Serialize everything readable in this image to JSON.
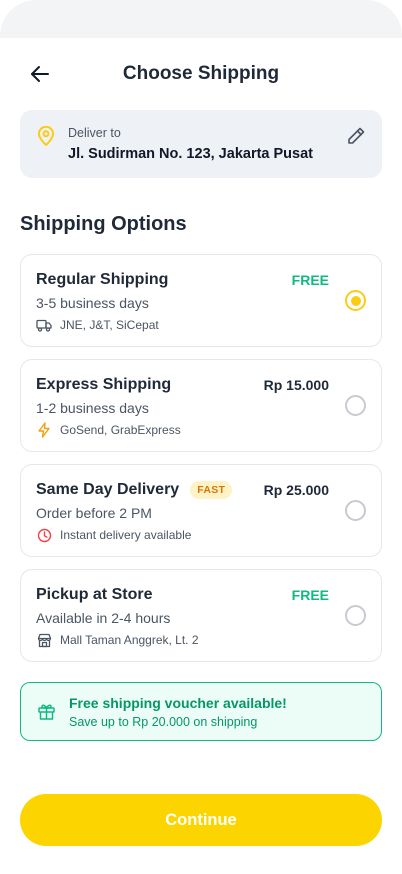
{
  "header": {
    "title": "Choose Shipping"
  },
  "address": {
    "label": "Deliver to",
    "value": "Jl. Sudirman No. 123, Jakarta Pusat"
  },
  "section_title": "Shipping Options",
  "options": [
    {
      "name": "Regular Shipping",
      "price": "FREE",
      "subtitle": "3-5 business days",
      "meta": "JNE, J&T, SiCepat",
      "meta_icon": "truck-icon",
      "selected": true
    },
    {
      "name": "Express Shipping",
      "price": "Rp 15.000",
      "subtitle": "1-2 business days",
      "meta": "GoSend, GrabExpress",
      "meta_icon": "lightning-icon",
      "selected": false
    },
    {
      "name": "Same Day Delivery",
      "badge": "FAST",
      "price": "Rp 25.000",
      "subtitle": "Order before 2 PM",
      "meta": "Instant delivery available",
      "meta_icon": "clock-icon",
      "selected": false
    },
    {
      "name": "Pickup at Store",
      "price": "FREE",
      "subtitle": "Available in 2-4 hours",
      "meta": "Mall Taman Anggrek, Lt. 2",
      "meta_icon": "store-icon",
      "selected": false
    }
  ],
  "voucher": {
    "title": "Free shipping voucher available!",
    "subtitle": "Save up to Rp 20.000 on shipping",
    "icon": "gift-icon"
  },
  "continue_label": "Continue",
  "colors": {
    "accent": "#fcd500",
    "free": "#10b981",
    "voucher_bg": "#ecfdf7",
    "fast_badge_bg": "#fef3c7",
    "fast_badge_text": "#d97706",
    "pin": "#facc15"
  }
}
